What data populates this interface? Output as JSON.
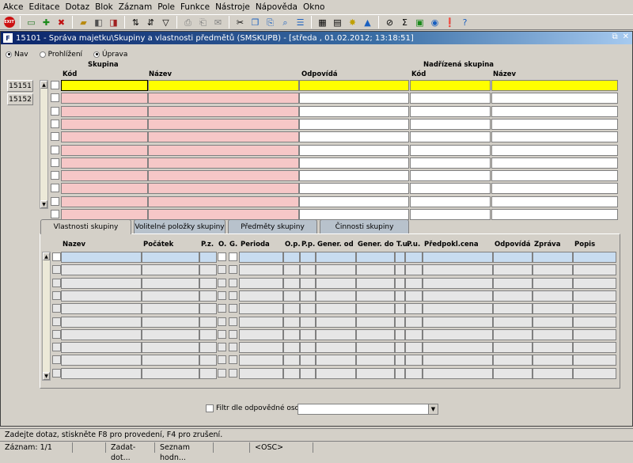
{
  "menu": [
    "Akce",
    "Editace",
    "Dotaz",
    "Blok",
    "Záznam",
    "Pole",
    "Funkce",
    "Nástroje",
    "Nápověda",
    "Okno"
  ],
  "toolbar": {
    "exit_label": "EXIT",
    "icons": [
      "save-icon",
      "insert-icon",
      "delete-icon",
      "folder-icon",
      "query-icon",
      "execute-icon",
      "sort-asc-icon",
      "sort-desc-icon",
      "filter-icon",
      "print-icon",
      "print-preview-icon",
      "mail-icon",
      "cut-icon",
      "copy-icon",
      "paste-icon",
      "find-icon",
      "list-icon",
      "calc-icon",
      "doc-icon",
      "star-icon",
      "triangle-icon",
      "export-icon",
      "target-icon",
      "sum-icon",
      "excel-icon",
      "globe-icon",
      "info-icon",
      "help-icon"
    ]
  },
  "window": {
    "title": "15101 - Správa majetku\\Skupiny a vlastnosti předmětů (SMSKUPB) - [středa , 01.02.2012; 13:18:51]",
    "controls": "⊟ ✕"
  },
  "mode": {
    "nav": "Nav",
    "browse": "Prohlížení",
    "edit": "Úprava",
    "selected": "edit"
  },
  "records": [
    "15151",
    "15152"
  ],
  "upper_grid": {
    "group_header": "Skupina",
    "parent_header": "Nadřízená skupina",
    "columns": [
      "Kód",
      "Název",
      "Odpovídá",
      "Kód",
      "Název"
    ],
    "row_count": 11
  },
  "tabs": [
    "Vlastnosti skupiny",
    "Volitelné položky skupiny",
    "Předměty skupiny",
    "Činnosti skupiny"
  ],
  "active_tab": 0,
  "lower_grid": {
    "columns": [
      "Nazev",
      "Počátek",
      "P.z.",
      "O.",
      "G.",
      "Perioda",
      "O.p.",
      "P.p.",
      "Gener. od",
      "Gener. do",
      "T.u.",
      "P.u.",
      "Předpokl.cena",
      "Odpovídá",
      "Zpráva",
      "Popis"
    ],
    "row_count": 10
  },
  "filter": {
    "label": "Filtr dle odpovědné osoby",
    "value": ""
  },
  "status": {
    "message": "Zadejte dotaz, stiskněte F8 pro provedení, F4 pro zrušení.",
    "record": "Záznam: 1/1",
    "field2": "",
    "mode": "Zadat-dot...",
    "list": "Seznam hodn...",
    "field5": "",
    "osc": "<OSC>"
  }
}
